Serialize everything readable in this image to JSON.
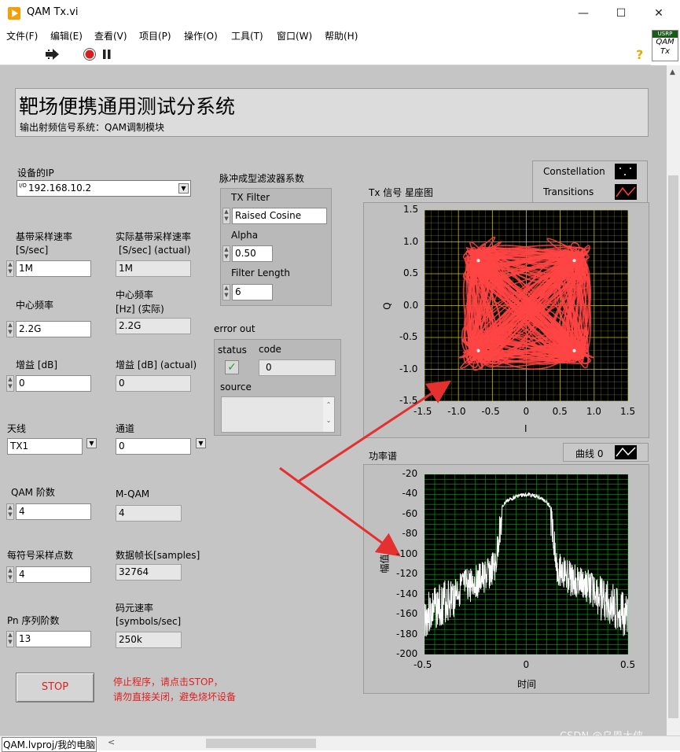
{
  "window": {
    "title": "QAM Tx.vi",
    "min": "—",
    "max": "☐",
    "close": "✕"
  },
  "menu": [
    "文件(F)",
    "编辑(E)",
    "查看(V)",
    "项目(P)",
    "操作(O)",
    "工具(T)",
    "窗口(W)",
    "帮助(H)"
  ],
  "vi_icon": {
    "top": "USRP",
    "line1": "QAM",
    "line2": "Tx"
  },
  "header": {
    "title": "靶场便携通用测试分系统",
    "subtitle": "输出射频信号系统：QAM调制模块"
  },
  "device_ip": {
    "label": "设备的IP",
    "value": "192.168.10.2",
    "prefix": "I/O"
  },
  "controls": {
    "baseband_rate": {
      "label1": "基带采样速率",
      "label2": "[S/sec]",
      "value": "1M"
    },
    "actual_baseband_rate": {
      "label1": "实际基带采样速率",
      "label2": "[S/sec] (actual)",
      "value": "1M"
    },
    "center_freq": {
      "label": "中心频率",
      "value": "2.2G"
    },
    "actual_center_freq": {
      "label1": "中心频率",
      "label2": "[Hz] (实际)",
      "value": "2.2G"
    },
    "gain": {
      "label": "增益 [dB]",
      "value": "0"
    },
    "actual_gain": {
      "label": "增益 [dB] (actual)",
      "value": "0"
    },
    "antenna": {
      "label": "天线",
      "value": "TX1"
    },
    "channel": {
      "label": "通道",
      "value": "0"
    },
    "qam_order": {
      "label": "QAM 阶数",
      "value": "4"
    },
    "m_qam": {
      "label": "M-QAM",
      "value": "4"
    },
    "samples_per_symbol": {
      "label": "每符号采样点数",
      "value": "4"
    },
    "frame_length": {
      "label": "数据帧长[samples]",
      "value": "32764"
    },
    "pn_order": {
      "label": "Pn 序列阶数",
      "value": "13"
    },
    "symbol_rate": {
      "label1": "码元速率",
      "label2": "[symbols/sec]",
      "value": "250k"
    }
  },
  "filter": {
    "cluster_label": "脉冲成型滤波器系数",
    "tx_filter_label": "TX Filter",
    "tx_filter_value": "Raised Cosine",
    "alpha_label": "Alpha",
    "alpha_value": "0.50",
    "length_label": "Filter Length",
    "length_value": "6"
  },
  "error_out": {
    "label": "error out",
    "status_label": "status",
    "code_label": "code",
    "code_value": "0",
    "source_label": "source",
    "status_mark": "✓"
  },
  "stop": {
    "label": "STOP",
    "note1": "停止程序，请点击STOP，",
    "note2": "请勿直接关闭，避免烧坏设备"
  },
  "constellation_graph": {
    "title": "Tx 信号 星座图",
    "legend": [
      "Constellation",
      "Transitions"
    ],
    "xlabel": "I",
    "ylabel": "Q",
    "xticks": [
      "-1.5",
      "-1.0",
      "-0.5",
      "0",
      "0.5",
      "1.0",
      "1.5"
    ],
    "yticks": [
      "1.5",
      "1.0",
      "0.5",
      "0.0",
      "-0.5",
      "-1.0",
      "-1.5"
    ]
  },
  "spectrum_graph": {
    "title": "功率谱",
    "legend": "曲线 0",
    "xlabel": "时间",
    "ylabel": "幅值",
    "xticks": [
      "-0.5",
      "0",
      "0.5"
    ],
    "yticks": [
      "-20",
      "-40",
      "-60",
      "-80",
      "-100",
      "-120",
      "-140",
      "-160",
      "-180",
      "-200"
    ]
  },
  "chart_data": [
    {
      "type": "scatter",
      "title": "Tx 信号 星座图",
      "xlabel": "I",
      "ylabel": "Q",
      "xlim": [
        -1.5,
        1.5
      ],
      "ylim": [
        -1.5,
        1.5
      ],
      "grid": true,
      "series": [
        {
          "name": "Constellation",
          "x": [
            -0.707,
            0.707,
            -0.707,
            0.707
          ],
          "y": [
            0.707,
            0.707,
            -0.707,
            -0.707
          ]
        }
      ],
      "colors": {
        "constellation": "#ffffff",
        "transitions": "#ff4444",
        "grid": "#d8d800",
        "background": "#000000"
      }
    },
    {
      "type": "line",
      "title": "功率谱",
      "xlabel": "时间",
      "ylabel": "幅值",
      "xlim": [
        -0.5,
        0.5
      ],
      "ylim": [
        -200,
        -20
      ],
      "grid": true,
      "series": [
        {
          "name": "曲线 0",
          "x": [
            -0.5,
            -0.4,
            -0.3,
            -0.2,
            -0.15,
            -0.13,
            -0.1,
            -0.05,
            0,
            0.05,
            0.1,
            0.13,
            0.15,
            0.2,
            0.3,
            0.4,
            0.5
          ],
          "y": [
            -140,
            -125,
            -115,
            -105,
            -95,
            -55,
            -45,
            -40,
            -38,
            -40,
            -45,
            -55,
            -95,
            -105,
            -115,
            -125,
            -140
          ]
        }
      ],
      "colors": {
        "line": "#ffffff",
        "grid": "#00aa00",
        "background": "#000000"
      }
    }
  ],
  "statusbar": {
    "path": "QAM.lvproj/我的电脑"
  },
  "watermark": "CSDN @乌恩大侠"
}
